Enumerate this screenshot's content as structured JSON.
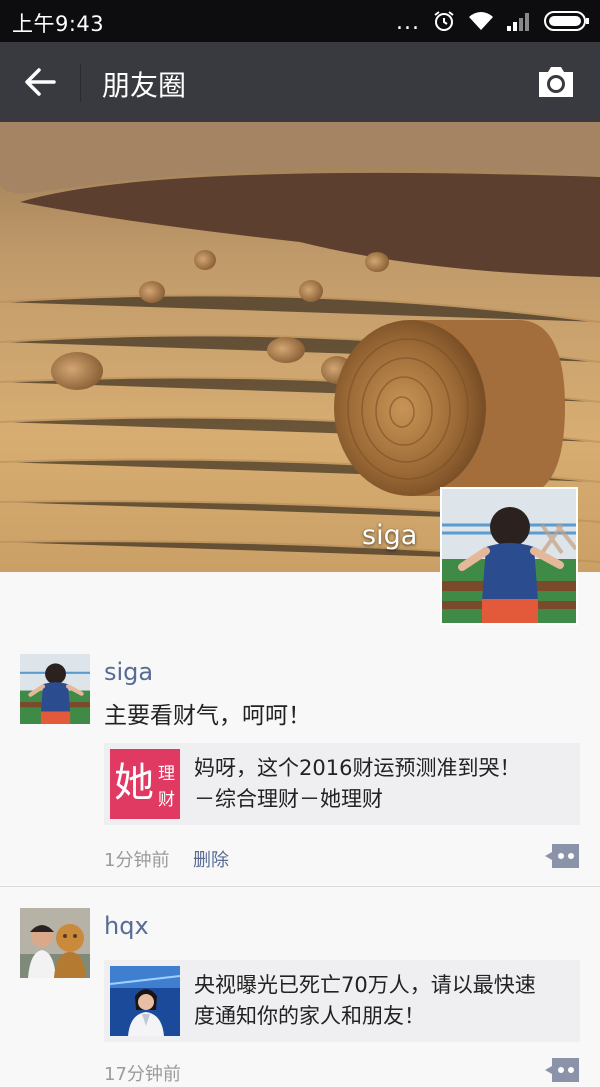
{
  "status_bar": {
    "time": "上午9:43",
    "dots": "..."
  },
  "nav": {
    "title": "朋友圈"
  },
  "cover": {
    "name": "siga"
  },
  "posts": [
    {
      "name": "siga",
      "text": "主要看财气，呵呵！",
      "link": {
        "thumb_char": "她",
        "thumb_side_1": "理",
        "thumb_side_2": "财",
        "line1": "妈呀，这个2016财运预测准到哭！",
        "line2": "－综合理财－她理财"
      },
      "time": "1分钟前",
      "delete": "删除"
    },
    {
      "name": "hqx",
      "link": {
        "line1": "央视曝光已死亡70万人，请以最快速",
        "line2": "度通知你的家人和朋友！"
      },
      "time": "17分钟前"
    }
  ],
  "colors": {
    "navbar": "#393a3f",
    "link_name": "#576b95",
    "card_bg": "#efeff2",
    "brand_pink": "#e03a63"
  },
  "icons": [
    "back-arrow-icon",
    "camera-icon",
    "alarm-icon",
    "wifi-icon",
    "signal-icon",
    "battery-icon",
    "comment-icon"
  ]
}
